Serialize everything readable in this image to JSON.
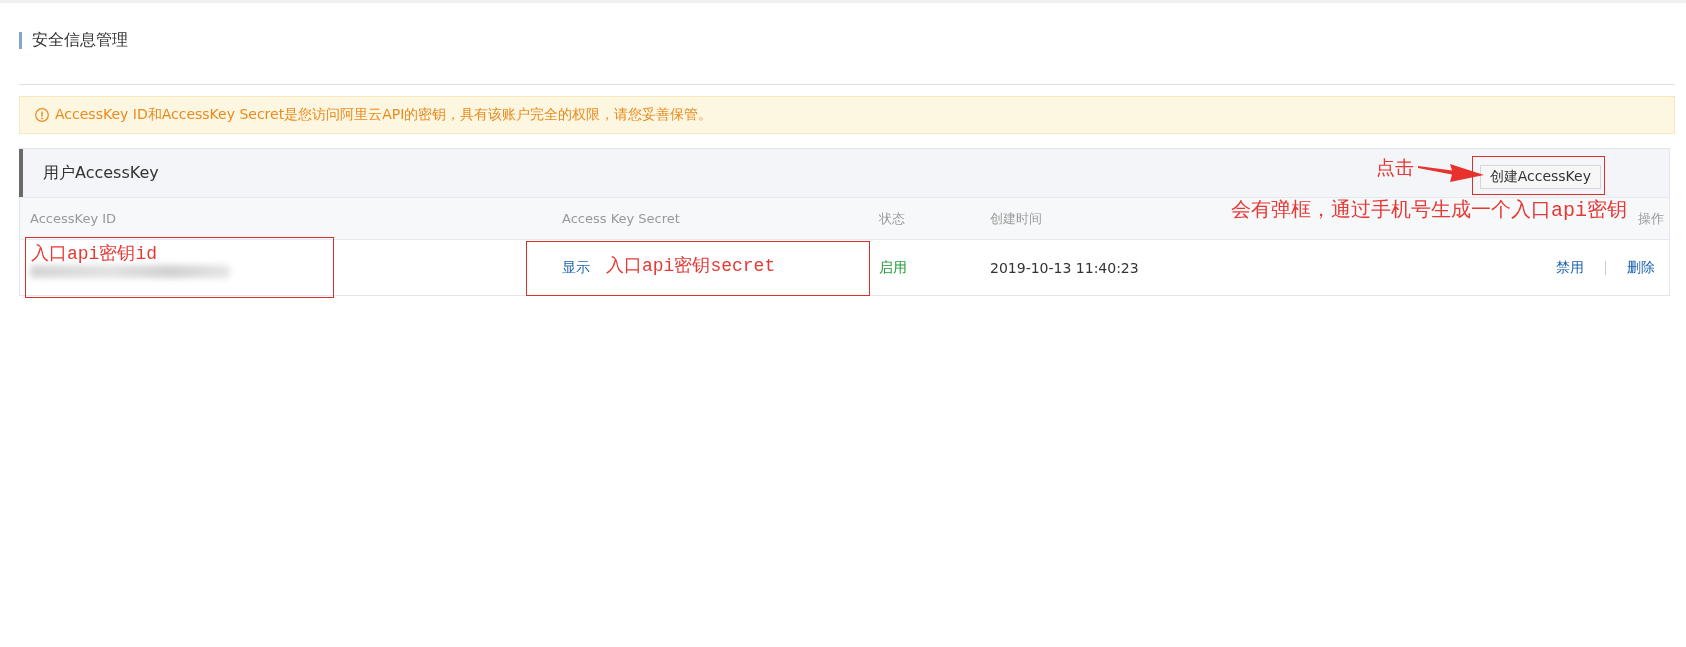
{
  "page": {
    "title": "安全信息管理"
  },
  "notice": {
    "text": "AccessKey ID和AccessKey Secret是您访问阿里云API的密钥，具有该账户完全的权限，请您妥善保管。"
  },
  "card": {
    "title": "用户AccessKey",
    "create_button": "创建AccessKey"
  },
  "table": {
    "columns": [
      "AccessKey ID",
      "Access Key Secret",
      "状态",
      "创建时间",
      "操作"
    ],
    "rows": [
      {
        "id_blurred": true,
        "secret_link": "显示",
        "status": "启用",
        "enabled": true,
        "created": "2019-10-13 11:40:23",
        "actions": [
          "禁用",
          "删除"
        ]
      }
    ]
  },
  "annotations": [
    {
      "kind": "framed-note",
      "text": "入口api密钥id"
    },
    {
      "kind": "framed-note",
      "text": "入口api密钥secret"
    },
    {
      "kind": "arrow-note",
      "text": "点击"
    },
    {
      "kind": "frame"
    },
    {
      "kind": "note",
      "text": "会有弹框，通过手机号生成一个入口api密钥"
    }
  ]
}
